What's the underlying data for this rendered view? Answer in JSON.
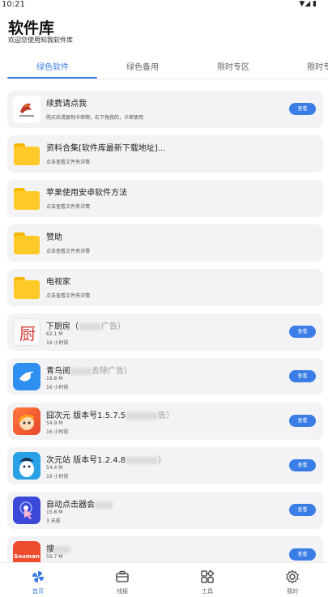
{
  "status": {
    "time": "10:21"
  },
  "header": {
    "title": "软件库",
    "subtitle": "欢迎您使用知我软件库"
  },
  "tabs": [
    "绿色软件",
    "绿色备用",
    "限时专区",
    "限时专区"
  ],
  "list": [
    {
      "icon": "logo-icon",
      "title": "续费请点我",
      "desc": "购买后请复制卡密啊，右下角我的，卡密使用",
      "button": "查看"
    },
    {
      "icon": "folder-icon",
      "title": "资料合集[软件库最新下载地址]...",
      "desc": "点击查看文件夹详情"
    },
    {
      "icon": "folder-icon",
      "title": "苹果使用安卓软件方法",
      "desc": "点击查看文件夹详情"
    },
    {
      "icon": "folder-icon",
      "title": "赞助",
      "desc": "点击查看文件夹详情"
    },
    {
      "icon": "folder-icon",
      "title": "电视家",
      "desc": "点击查看文件夹详情"
    },
    {
      "icon": "kitchen-icon",
      "title": "下厨房（",
      "title_tail": "广告）",
      "size": "62.1 M",
      "age": "16 小时前",
      "button": "查看"
    },
    {
      "icon": "bird-icon",
      "title": "青鸟阅",
      "title_tail": "去除广告）",
      "size": "19.8 M",
      "age": "16 小时前",
      "button": "查看"
    },
    {
      "icon": "anime-icon",
      "title": "囧次元 版本号1.5.7.5",
      "title_tail": "告）",
      "size": "54.9 M",
      "age": "16 小时前",
      "button": "查看"
    },
    {
      "icon": "penguin-icon",
      "title": "次元站 版本号1.2.4.8",
      "title_tail": "）",
      "size": "54.4 M",
      "age": "16 小时前",
      "button": "查看"
    },
    {
      "icon": "tap-icon",
      "title": "自动点击器会",
      "size": "15.8 M",
      "age": "3 天前",
      "button": "查看"
    },
    {
      "icon": "souman-icon",
      "title": "搜",
      "size": "59.7 M",
      "button": "查看",
      "logo_text": "Souman"
    }
  ],
  "nav": [
    "首页",
    "线报",
    "工具",
    "我的"
  ],
  "colors": {
    "accent": "#3b7de6",
    "card": "#f3f3f5",
    "folder": "#ffca28"
  }
}
